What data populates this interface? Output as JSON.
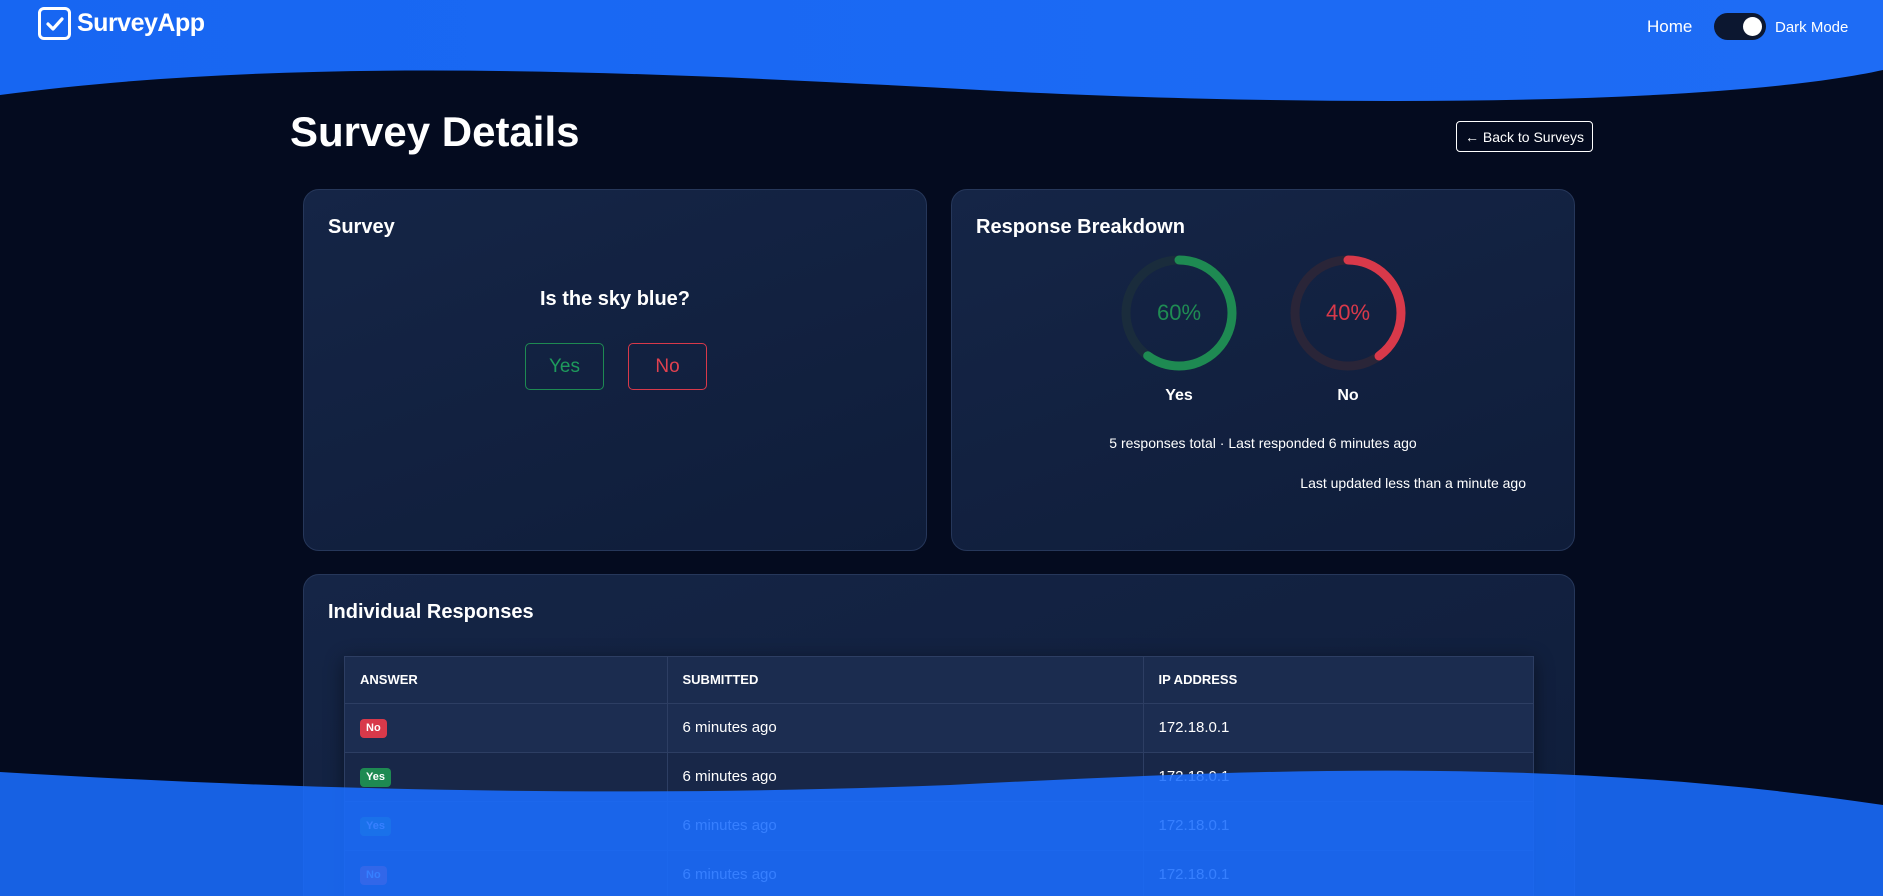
{
  "navbar": {
    "brand": "SurveyApp",
    "brand_icon": "check-square-icon",
    "home_label": "Home",
    "dark_mode_label": "Dark Mode",
    "dark_mode_on": true
  },
  "page": {
    "title": "Survey Details",
    "back_label": "← Back to Surveys"
  },
  "survey_card": {
    "title": "Survey",
    "question": "Is the sky blue?",
    "yes_label": "Yes",
    "no_label": "No"
  },
  "breakdown": {
    "title": "Response Breakdown",
    "yes": {
      "percent": 60,
      "percent_label": "60%",
      "label": "Yes",
      "color": "#1e8a52"
    },
    "no": {
      "percent": 40,
      "percent_label": "40%",
      "label": "No",
      "color": "#d8394a"
    },
    "summary": "5 responses total · Last responded 6 minutes ago",
    "updated": "Last updated less than a minute ago"
  },
  "responses": {
    "title": "Individual Responses",
    "columns": [
      "ANSWER",
      "SUBMITTED",
      "IP ADDRESS"
    ],
    "rows": [
      {
        "answer": "No",
        "submitted": "6 minutes ago",
        "ip": "172.18.0.1"
      },
      {
        "answer": "Yes",
        "submitted": "6 minutes ago",
        "ip": "172.18.0.1"
      },
      {
        "answer": "Yes",
        "submitted": "6 minutes ago",
        "ip": "172.18.0.1"
      },
      {
        "answer": "No",
        "submitted": "6 minutes ago",
        "ip": "172.18.0.1"
      }
    ]
  },
  "colors": {
    "brand_blue": "#1a6dff",
    "background": "#040b1f",
    "yes": "#1e8a52",
    "no": "#d8394a"
  }
}
